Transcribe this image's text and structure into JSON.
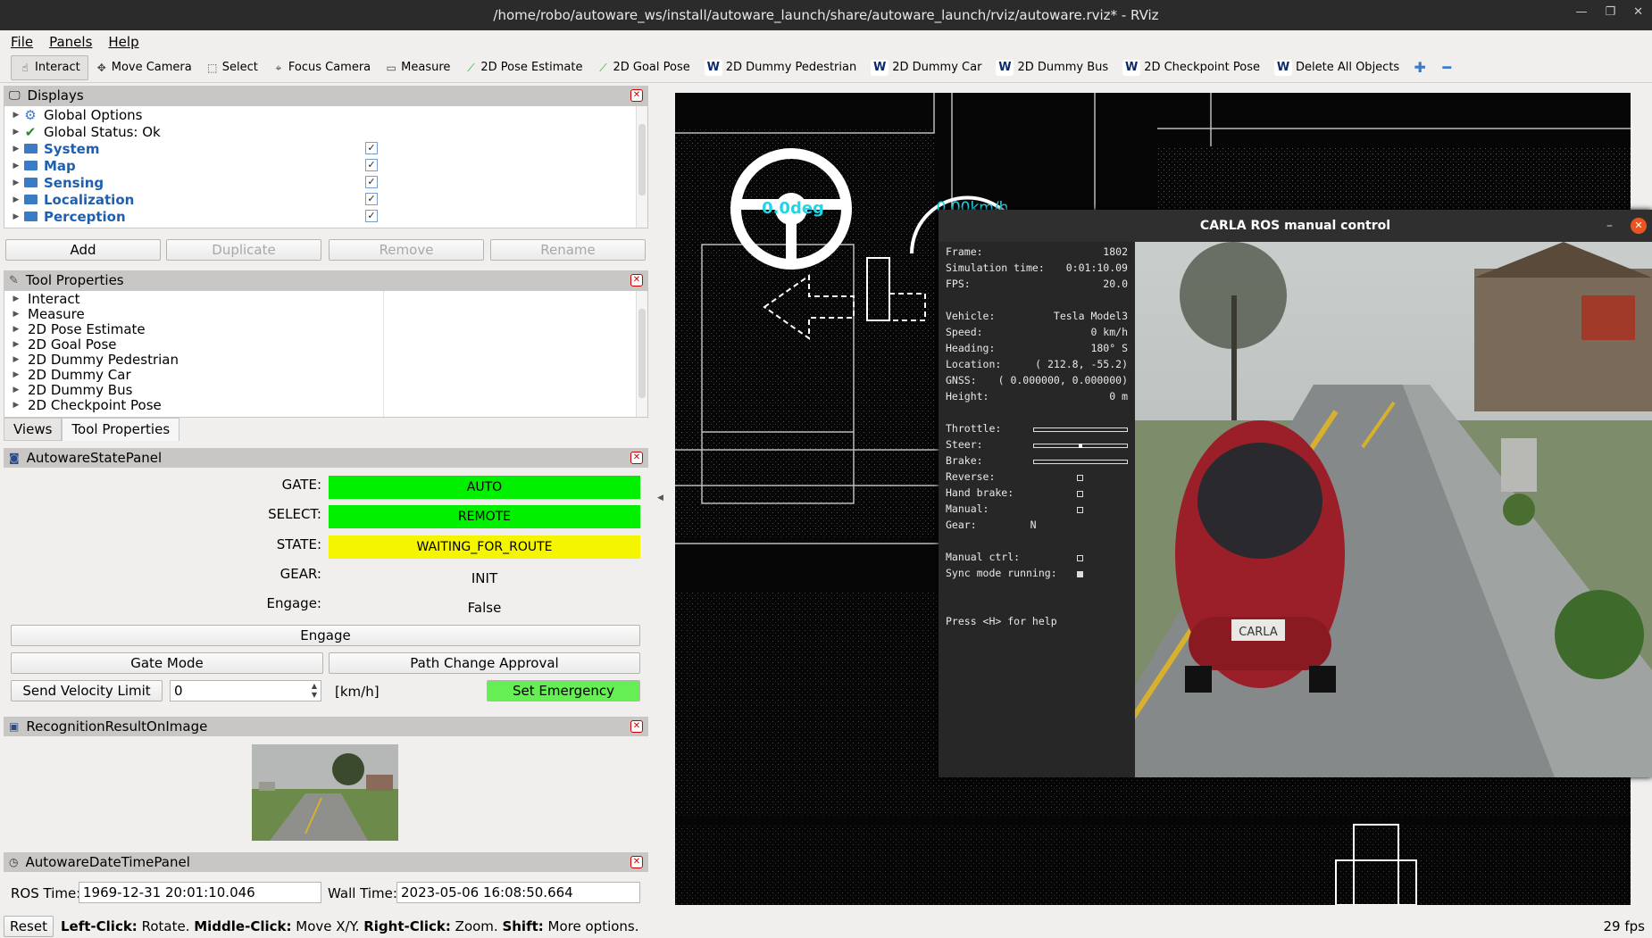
{
  "window": {
    "title": "/home/robo/autoware_ws/install/autoware_launch/share/autoware_launch/rviz/autoware.rviz* - RViz"
  },
  "menu": [
    "File",
    "Panels",
    "Help"
  ],
  "toolbar": [
    {
      "label": "Interact",
      "icon": "hand-icon",
      "active": true
    },
    {
      "label": "Move Camera",
      "icon": "move-icon"
    },
    {
      "label": "Select",
      "icon": "select-icon"
    },
    {
      "label": "Focus Camera",
      "icon": "focus-icon"
    },
    {
      "label": "Measure",
      "icon": "ruler-icon"
    },
    {
      "label": "2D Pose Estimate",
      "icon": "arrow-green-icon"
    },
    {
      "label": "2D Goal Pose",
      "icon": "arrow-green-icon"
    },
    {
      "label": "2D Dummy Pedestrian",
      "icon": "autoware-icon"
    },
    {
      "label": "2D Dummy Car",
      "icon": "autoware-icon"
    },
    {
      "label": "2D Dummy Bus",
      "icon": "autoware-icon"
    },
    {
      "label": "2D Checkpoint Pose",
      "icon": "autoware-icon"
    },
    {
      "label": "Delete All Objects",
      "icon": "autoware-icon"
    }
  ],
  "displays": {
    "title": "Displays",
    "items": [
      {
        "label": "Global Options",
        "icon": "gear-icon",
        "checked": null,
        "folder": false
      },
      {
        "label": "Global Status: Ok",
        "icon": "check-icon",
        "checked": null,
        "folder": false
      },
      {
        "label": "System",
        "checked": true,
        "folder": true
      },
      {
        "label": "Map",
        "checked": true,
        "folder": true
      },
      {
        "label": "Sensing",
        "checked": true,
        "folder": true
      },
      {
        "label": "Localization",
        "checked": true,
        "folder": true
      },
      {
        "label": "Perception",
        "checked": true,
        "folder": true
      }
    ],
    "buttons": {
      "add": "Add",
      "duplicate": "Duplicate",
      "remove": "Remove",
      "rename": "Rename"
    }
  },
  "tool_properties": {
    "title": "Tool Properties",
    "items": [
      "Interact",
      "Measure",
      "2D Pose Estimate",
      "2D Goal Pose",
      "2D Dummy Pedestrian",
      "2D Dummy Car",
      "2D Dummy Bus",
      "2D Checkpoint Pose"
    ]
  },
  "tabs": [
    "Views",
    "Tool Properties"
  ],
  "autoware_state": {
    "title": "AutowareStatePanel",
    "gate_label": "GATE:",
    "gate_value": "AUTO",
    "gate_color": "#00f000",
    "select_label": "SELECT:",
    "select_value": "REMOTE",
    "select_color": "#00f000",
    "state_label": "STATE:",
    "state_value": "WAITING_FOR_ROUTE",
    "state_color": "#f5f500",
    "gear_label": "GEAR:",
    "gear_value": "INIT",
    "engage_label": "Engage:",
    "engage_value": "False",
    "engage_button": "Engage",
    "gate_mode_button": "Gate Mode",
    "path_change_button": "Path Change Approval",
    "send_velocity_button": "Send Velocity Limit",
    "velocity_value": "0",
    "unit": "[km/h]",
    "emergency_button": "Set Emergency",
    "emergency_color": "#66ee55"
  },
  "recognition": {
    "title": "RecognitionResultOnImage"
  },
  "datetime": {
    "title": "AutowareDateTimePanel",
    "ros_label": "ROS Time:",
    "ros_value": "1969-12-31 20:01:10.046",
    "wall_label": "Wall Time:",
    "wall_value": "2023-05-06 16:08:50.664"
  },
  "viewport": {
    "steering": "0.0deg",
    "speed": "0.00km/h",
    "accent": "#22d4e8"
  },
  "carla": {
    "title": "CARLA ROS manual control",
    "hud": [
      [
        "Frame:",
        "1802"
      ],
      [
        "Simulation time:",
        "0:01:10.09"
      ],
      [
        "FPS:",
        "20.0"
      ],
      [
        "",
        ""
      ],
      [
        "Vehicle:",
        "Tesla Model3"
      ],
      [
        "Speed:",
        "0 km/h"
      ],
      [
        "Heading:",
        "180° S"
      ],
      [
        "Location:",
        "( 212.8, -55.2)"
      ],
      [
        "GNSS:",
        "( 0.000000, 0.000000)"
      ],
      [
        "Height:",
        "0 m"
      ]
    ],
    "controls": {
      "throttle": "Throttle:",
      "steer": "Steer:",
      "brake": "Brake:",
      "reverse": "Reverse:",
      "hand_brake": "Hand brake:",
      "manual": "Manual:",
      "gear": "Gear:",
      "gear_value": "N",
      "manual_ctrl": "Manual ctrl:",
      "sync_mode": "Sync mode running:",
      "help": "Press <H> for help"
    },
    "plate": "CARLA"
  },
  "status": {
    "reset": "Reset",
    "hint_lc": "Left-Click:",
    "hint_lc_t": " Rotate. ",
    "hint_mc": "Middle-Click:",
    "hint_mc_t": " Move X/Y. ",
    "hint_rc": "Right-Click:",
    "hint_rc_t": " Zoom. ",
    "hint_sh": "Shift:",
    "hint_sh_t": " More options.",
    "fps": "29 fps"
  }
}
